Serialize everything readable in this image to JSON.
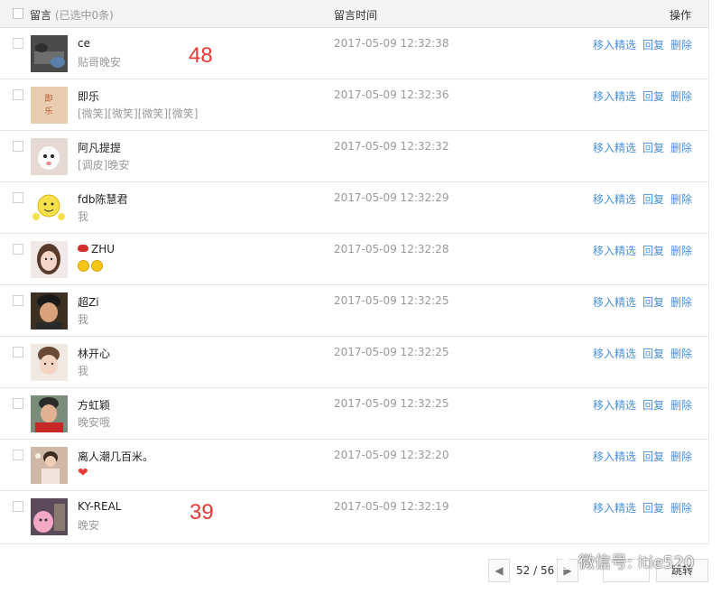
{
  "header": {
    "title": "留言",
    "selected": "(已选中0条)",
    "time_col": "留言时间",
    "ops_col": "操作"
  },
  "actions": {
    "move": "移入精选",
    "reply": "回复",
    "delete": "删除"
  },
  "rows": [
    {
      "name": "ce",
      "message": "贴哥晚安",
      "time": "2017-05-09 12:32:38"
    },
    {
      "name": "即乐",
      "message": "[微笑][微笑][微笑][微笑]",
      "time": "2017-05-09 12:32:36"
    },
    {
      "name": "阿凡提提",
      "message": "[调皮]晚安",
      "time": "2017-05-09 12:32:32"
    },
    {
      "name": "fdb陈慧君",
      "message": "我",
      "time": "2017-05-09 12:32:29"
    },
    {
      "name": "ZHU",
      "message": "",
      "time": "2017-05-09 12:32:28"
    },
    {
      "name": "超Zi",
      "message": "我",
      "time": "2017-05-09 12:32:25"
    },
    {
      "name": "林开心",
      "message": "我",
      "time": "2017-05-09 12:32:25"
    },
    {
      "name": "方虹颖",
      "message": "晚安哦",
      "time": "2017-05-09 12:32:25"
    },
    {
      "name": "离人潮几百米。",
      "message": "",
      "time": "2017-05-09 12:32:20"
    },
    {
      "name": "KY-REAL",
      "message": "晚安",
      "time": "2017-05-09 12:32:19"
    }
  ],
  "annotations": {
    "top": "48",
    "bottom": "39"
  },
  "pagination": {
    "info": "52 / 56",
    "prev": "◀",
    "next": "▶",
    "jump": "跳转"
  },
  "watermark": "微信号: itie520"
}
